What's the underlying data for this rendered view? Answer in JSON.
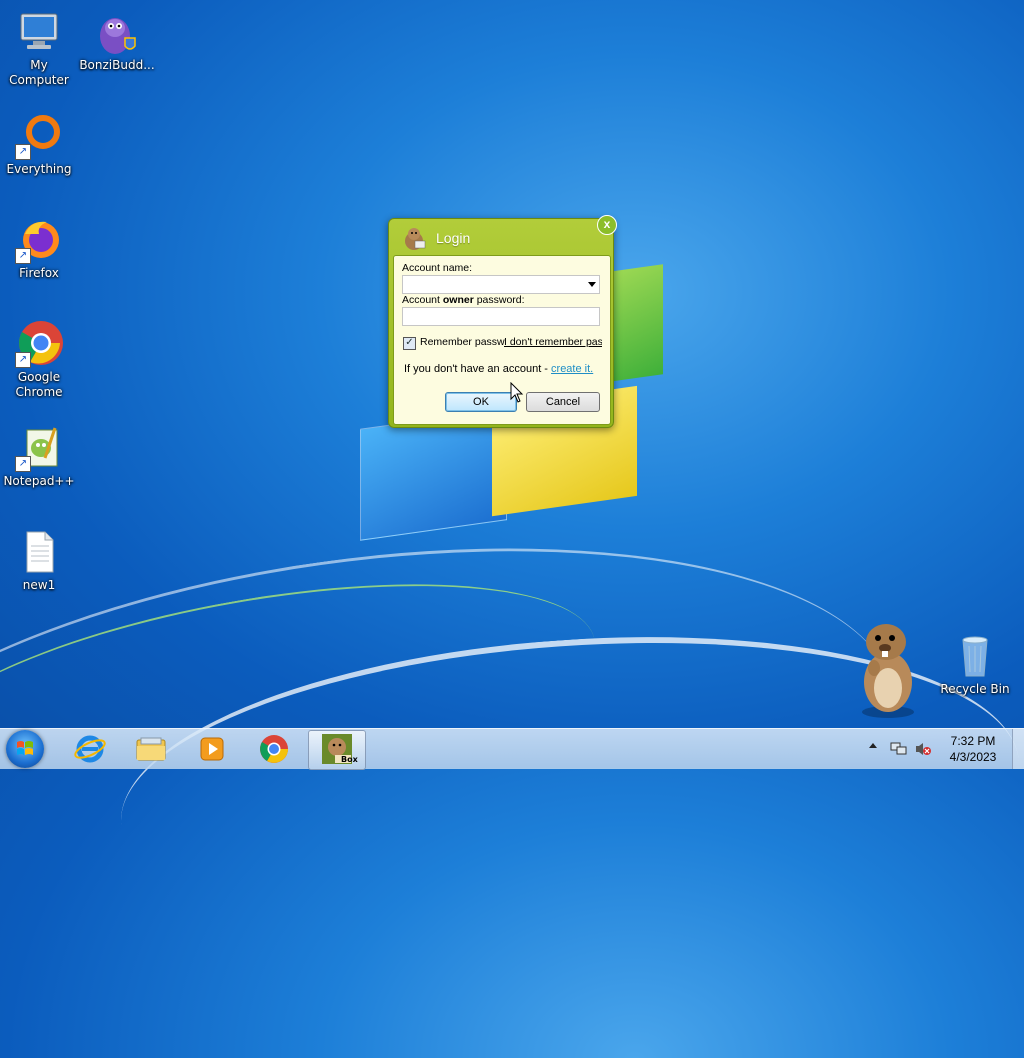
{
  "desktop": {
    "icons": [
      {
        "label": "My Computer",
        "icon": "computer-icon"
      },
      {
        "label": "BonziBudd...",
        "icon": "bonzi-icon"
      },
      {
        "label": "Everything",
        "icon": "everything-icon"
      },
      {
        "label": "Firefox",
        "icon": "firefox-icon"
      },
      {
        "label": "Google Chrome",
        "icon": "chrome-icon"
      },
      {
        "label": "Notepad++",
        "icon": "notepadpp-icon"
      },
      {
        "label": "new1",
        "icon": "text-file-icon"
      },
      {
        "label": "Recycle Bin",
        "icon": "recycle-bin-icon"
      }
    ]
  },
  "dialog": {
    "title": "Login",
    "close_label": "x",
    "account_name_label": "Account name:",
    "account_name_value": "",
    "password_label_pre": "Account ",
    "password_label_bold": "owner",
    "password_label_post": " password:",
    "password_value": "",
    "remember_label": "Remember passw",
    "remember_checked": true,
    "forgot_link": "I don't remember pas",
    "no_account_text": "If you don't have an account - ",
    "create_link": "create it.",
    "ok_label": "OK",
    "cancel_label": "Cancel"
  },
  "taskbar": {
    "items": [
      "start-button",
      "internet-explorer-icon",
      "file-explorer-icon",
      "media-player-icon",
      "chrome-icon",
      "box-app-icon"
    ],
    "active_item_label": "Box",
    "clock_time": "7:32 PM",
    "clock_date": "4/3/2023"
  },
  "colors": {
    "dialog_frame": "#9bbb24",
    "dialog_panel": "#fdfce0",
    "link": "#1f8ec6"
  }
}
